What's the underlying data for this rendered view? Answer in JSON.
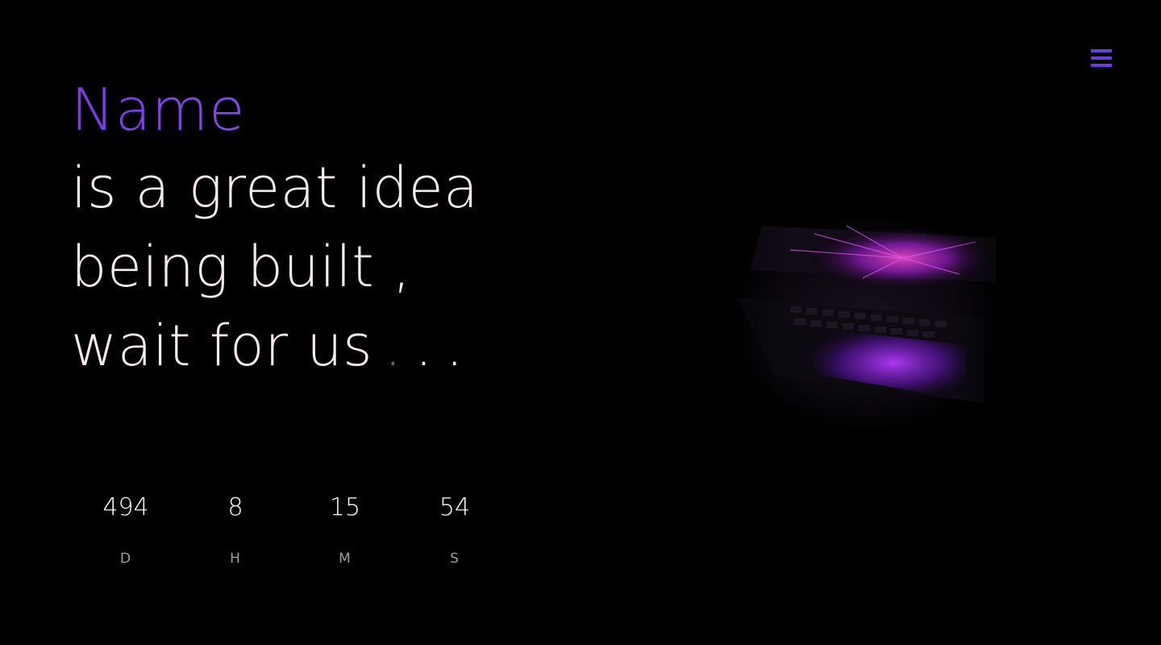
{
  "header": {
    "menu_icon": "hamburger-menu-icon",
    "accent_color": "#6a3fd8"
  },
  "hero": {
    "brand_name": "Name",
    "lines": [
      "is a great idea",
      "being built ,",
      "wait for us"
    ],
    "ellipsis": [
      ".",
      ".",
      "."
    ],
    "brand_gradient": [
      "#7b39e6",
      "#9a60f0"
    ],
    "text_color": "#f8eaf3",
    "image": "laptop-keyboard-with-purple-light-image"
  },
  "countdown": {
    "units": [
      {
        "value": "494",
        "label": "D"
      },
      {
        "value": "8",
        "label": "H"
      },
      {
        "value": "15",
        "label": "M"
      },
      {
        "value": "54",
        "label": "S"
      }
    ]
  }
}
